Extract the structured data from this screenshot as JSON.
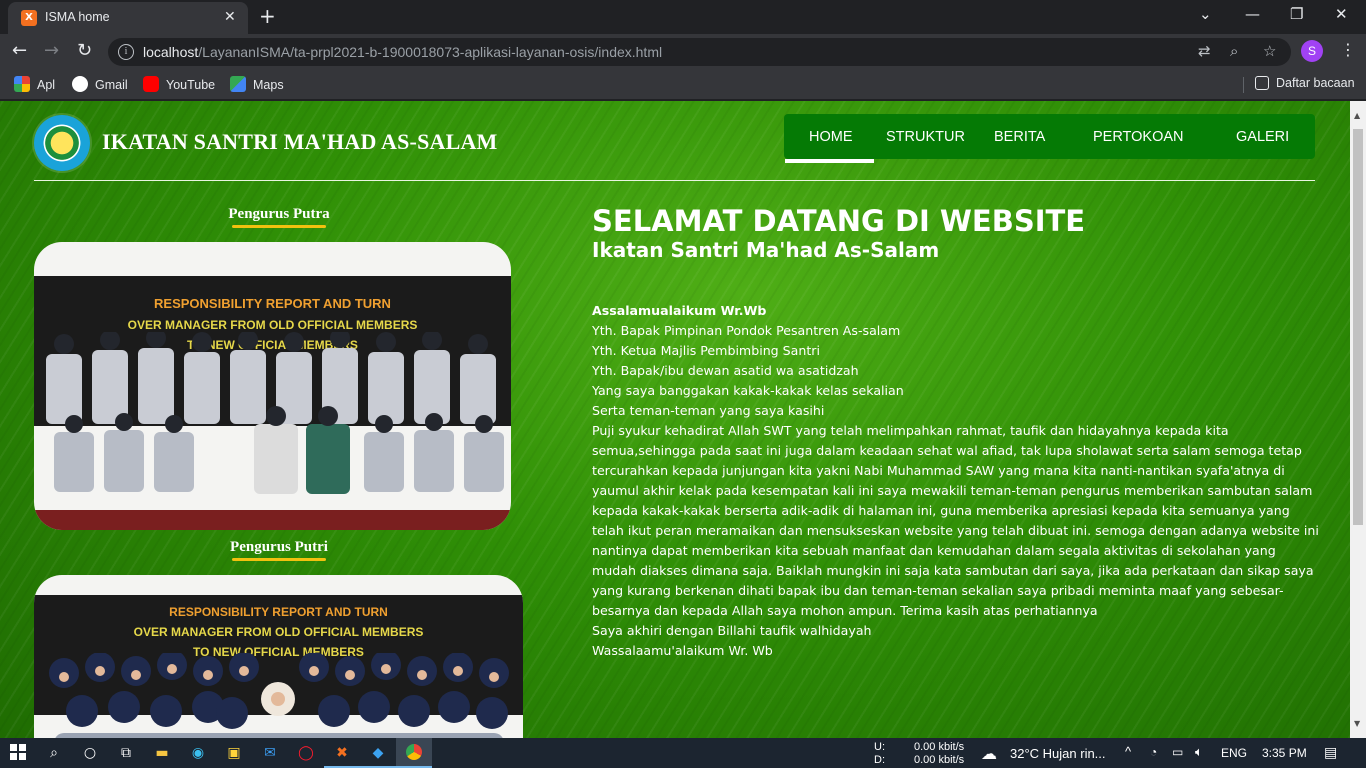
{
  "browser": {
    "tab_title": "ISMA home",
    "tab_favicon": "X",
    "url_host": "localhost",
    "url_path": "/LayananISMA/ta-prpl2021-b-1900018073-aplikasi-layanan-osis/index.html",
    "profile_initial": "S",
    "bookmarks": [
      {
        "label": "Apl",
        "icon": "apps-grid-icon",
        "color": "#ea4335"
      },
      {
        "label": "Gmail",
        "icon": "gmail-icon",
        "color": "#ffffff"
      },
      {
        "label": "YouTube",
        "icon": "youtube-icon",
        "color": "#ff0000"
      },
      {
        "label": "Maps",
        "icon": "maps-icon",
        "color": "#34a853"
      }
    ],
    "reading_list_label": "Daftar bacaan"
  },
  "site": {
    "title": "IKATAN SANTRI MA'HAD AS-SALAM",
    "nav": [
      {
        "label": "HOME",
        "active": true
      },
      {
        "label": "STRUKTUR",
        "active": false
      },
      {
        "label": "BERITA",
        "active": false
      },
      {
        "label": "PERTOKOAN",
        "active": false
      },
      {
        "label": "GALERI",
        "active": false
      }
    ],
    "accent_color": "#057a05",
    "underline_color": "#f2c10f"
  },
  "sidebar": {
    "putra_label": "Pengurus Putra",
    "putri_label": "Pengurus Putri",
    "banner_lines": [
      "RESPONSIBILITY REPORT AND TURN",
      "OVER MANAGER FROM OLD OFFICIAL MEMBERS",
      "TO NEW OFFICIAL MEMBERS"
    ]
  },
  "main": {
    "heading": "SELAMAT DATANG DI WEBSITE",
    "subheading": "Ikatan Santri Ma'had As-Salam",
    "greeting": "Assalamualaikum Wr.Wb",
    "lines": [
      "Yth. Bapak Pimpinan Pondok Pesantren As-salam",
      "Yth. Ketua Majlis Pembimbing Santri",
      "Yth. Bapak/ibu dewan asatid wa asatidzah",
      "Yang saya banggakan kakak-kakak kelas sekalian",
      "Serta teman-teman yang saya kasihi"
    ],
    "body": "Puji syukur kehadirat Allah SWT yang telah melimpahkan rahmat, taufik dan hidayahnya kepada kita semua,sehingga pada saat ini juga dalam keadaan sehat wal afiad, tak lupa sholawat serta salam semoga tetap tercurahkan kepada junjungan kita yakni Nabi Muhammad SAW yang mana kita nanti-nantikan syafa'atnya di yaumul akhir kelak pada kesempatan kali ini saya mewakili teman-teman pengurus memberikan sambutan salam kepada kakak-kakak berserta adik-adik di halaman ini, guna memberika apresiasi kepada kita semuanya yang telah ikut peran meramaikan dan mensukseskan website yang telah dibuat ini. semoga dengan adanya website ini nantinya dapat memberikan kita sebuah manfaat dan kemudahan dalam segala aktivitas di sekolahan yang mudah diakses dimana saja. Baiklah mungkin ini saja kata sambutan dari saya, jika ada perkataan dan sikap saya yang kurang berkenan dihati bapak ibu dan teman-teman sekalian saya pribadi meminta maaf yang sebesar-besarnya dan kepada Allah saya mohon ampun. Terima kasih atas perhatiannya",
    "closing1": "Saya akhiri dengan Billahi taufik walhidayah",
    "closing2": "Wassalaamu'alaikum Wr. Wb"
  },
  "taskbar": {
    "net_up_label": "U:",
    "net_down_label": "D:",
    "net_up": "0.00 kbit/s",
    "net_down": "0.00 kbit/s",
    "weather": "32°C  Hujan rin...",
    "lang": "ENG",
    "time": "3:35 PM"
  }
}
